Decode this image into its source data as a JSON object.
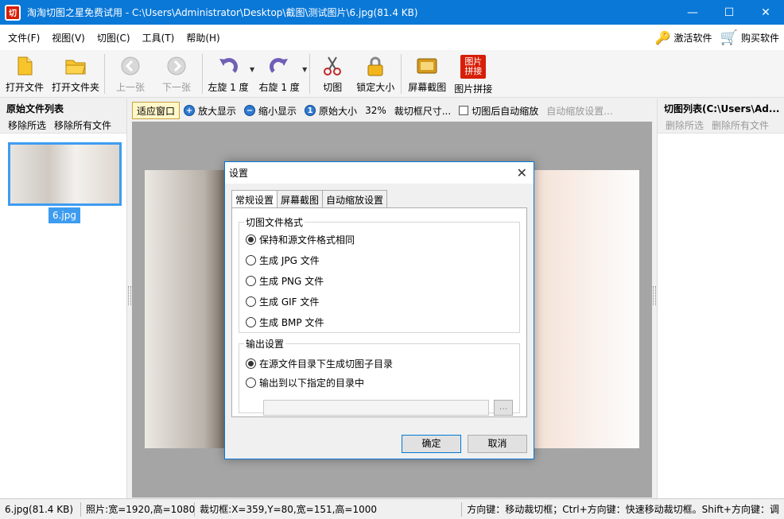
{
  "window": {
    "title": "淘淘切图之星免费试用 - C:\\Users\\Administrator\\Desktop\\截图\\测试图片\\6.jpg(81.4 KB)",
    "logo": "切"
  },
  "menu": {
    "items": [
      "文件(F)",
      "视图(V)",
      "切图(C)",
      "工具(T)",
      "帮助(H)"
    ],
    "activate": "激活软件",
    "buy": "购买软件"
  },
  "toolbar": {
    "open_file": "打开文件",
    "open_folder": "打开文件夹",
    "prev": "上一张",
    "next": "下一张",
    "rotate_left": "左旋 1 度",
    "rotate_right": "右旋 1 度",
    "cut": "切图",
    "lock_size": "锁定大小",
    "screenshot": "屏幕截图",
    "stitch": "图片拼接",
    "stitch_icon_text": "图片\n拼接"
  },
  "left_panel": {
    "title": "原始文件列表",
    "remove_selected": "移除所选",
    "remove_all": "移除所有文件",
    "file_name": "6.jpg"
  },
  "right_panel": {
    "title": "切图列表(C:\\Users\\Ad...",
    "remove_selected": "删除所选",
    "remove_all": "删除所有文件"
  },
  "viewbar": {
    "fit": "适应窗口",
    "zoom_in": "放大显示",
    "zoom_out": "缩小显示",
    "original": "原始大小",
    "percent": "32%",
    "crop_size": "裁切框尺寸...",
    "auto_scale": "切图后自动缩放",
    "auto_scale_settings": "自动缩放设置..."
  },
  "statusbar": {
    "file": "6.jpg(81.4 KB)",
    "photo": "照片:宽=1920,高=1080",
    "crop": "裁切框:X=359,Y=80,宽=151,高=1000",
    "hint": "方向键：移动裁切框；Ctrl+方向键：快速移动裁切框。Shift+方向键：调"
  },
  "dialog": {
    "title": "设置",
    "tabs": [
      "常规设置",
      "屏幕截图",
      "自动缩放设置"
    ],
    "format_group": "切图文件格式",
    "format_options": [
      "保持和源文件格式相同",
      "生成 JPG 文件",
      "生成 PNG 文件",
      "生成 GIF 文件",
      "生成 BMP 文件"
    ],
    "format_selected": 0,
    "output_group": "输出设置",
    "output_options": [
      "在源文件目录下生成切图子目录",
      "输出到以下指定的目录中"
    ],
    "output_selected": 0,
    "path_value": "",
    "browse": "...",
    "ok": "确定",
    "cancel": "取消"
  },
  "colors": {
    "title_bar": "#0a78d7",
    "accent": "#3d9cf0",
    "brand_red": "#d81e06"
  }
}
